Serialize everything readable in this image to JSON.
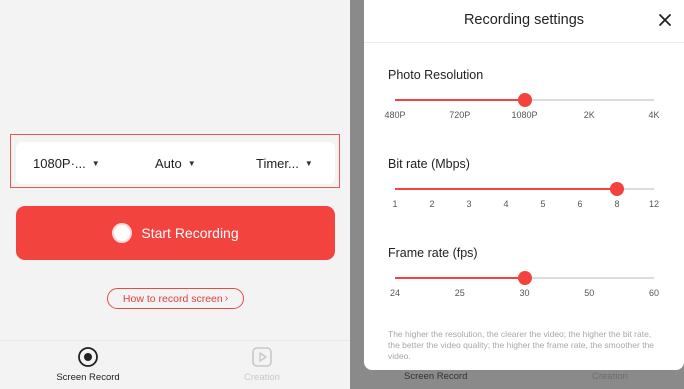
{
  "record": {
    "resolution_label": "1080P·...",
    "orientation_label": "Auto",
    "timer_label": "Timer...",
    "start_label": "Start Recording",
    "howto_label": "How to record screen"
  },
  "tabbar": {
    "tabs": [
      {
        "label": "Screen Record"
      },
      {
        "label": "Creation"
      }
    ]
  },
  "settings": {
    "title": "Recording settings",
    "sliders": [
      {
        "label": "Photo Resolution",
        "ticks": [
          "480P",
          "720P",
          "1080P",
          "2K",
          "4K"
        ],
        "value_index": 2
      },
      {
        "label": "Bit rate (Mbps)",
        "ticks": [
          "1",
          "2",
          "3",
          "4",
          "5",
          "6",
          "8",
          "12"
        ],
        "value_index": 6
      },
      {
        "label": "Frame rate (fps)",
        "ticks": [
          "24",
          "25",
          "30",
          "50",
          "60"
        ],
        "value_index": 2
      }
    ],
    "note": "The higher the resolution, the clearer the video; the higher the bit rate, the better the video quality; the higher the frame rate, the smoother the video."
  },
  "colors": {
    "accent": "#f2433f",
    "track": "#dcdcdc",
    "background_left": "#f3f3f3",
    "overlay": "#8a8a8a"
  },
  "icons": {
    "close": "close-icon",
    "record_tab": "record-icon",
    "creation_tab": "video-play-icon",
    "dropdown": "caret-down-icon"
  }
}
